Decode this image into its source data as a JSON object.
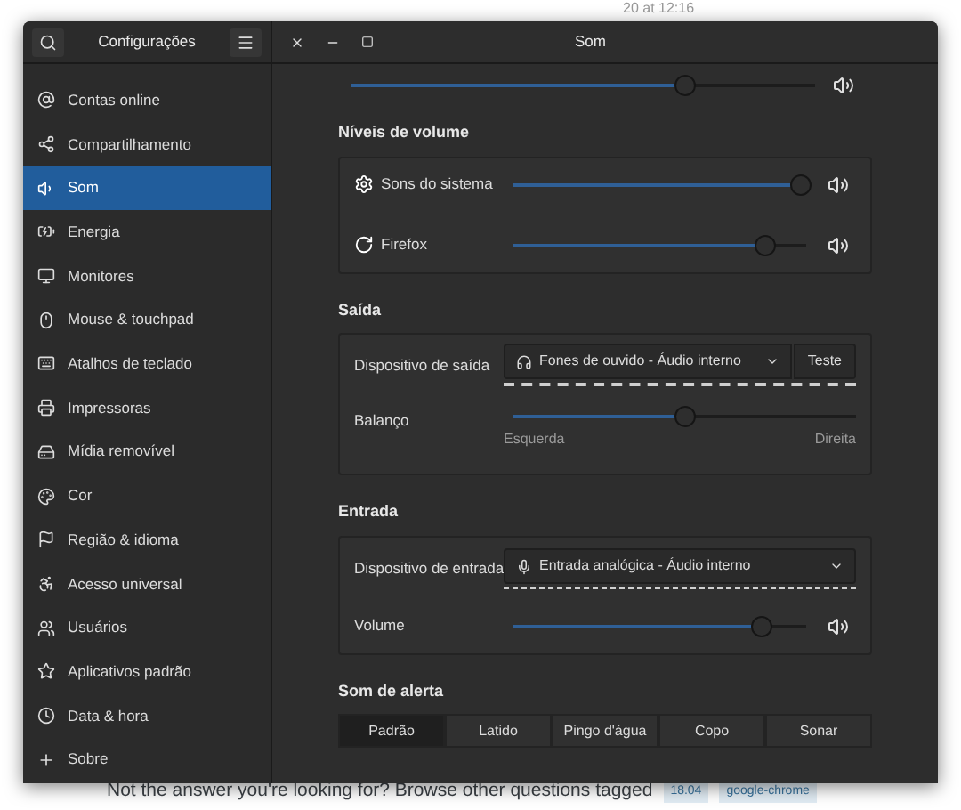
{
  "background_page": {
    "timestamp": "20 at 12:16",
    "footer_text": "Not the answer you're looking for? Browse other questions tagged",
    "tags": [
      "18.04",
      "google-chrome"
    ]
  },
  "sidebar": {
    "title": "Configurações",
    "items": [
      {
        "label": "Contas online",
        "selected": false
      },
      {
        "label": "Compartilhamento",
        "selected": false
      },
      {
        "label": "Som",
        "selected": true
      },
      {
        "label": "Energia",
        "selected": false
      },
      {
        "label": "Monitores",
        "selected": false
      },
      {
        "label": "Mouse & touchpad",
        "selected": false
      },
      {
        "label": "Atalhos de teclado",
        "selected": false
      },
      {
        "label": "Impressoras",
        "selected": false
      },
      {
        "label": "Mídia removível",
        "selected": false
      },
      {
        "label": "Cor",
        "selected": false
      },
      {
        "label": "Região & idioma",
        "selected": false
      },
      {
        "label": "Acesso universal",
        "selected": false
      },
      {
        "label": "Usuários",
        "selected": false
      },
      {
        "label": "Aplicativos padrão",
        "selected": false
      },
      {
        "label": "Data & hora",
        "selected": false
      },
      {
        "label": "Sobre",
        "selected": false
      }
    ]
  },
  "window": {
    "title": "Som"
  },
  "master_volume": {
    "level": 0.72
  },
  "volume_levels": {
    "heading": "Níveis de volume",
    "apps": [
      {
        "kind": "system",
        "name": "Sons do sistema",
        "level": 0.98
      },
      {
        "kind": "app",
        "name": "Firefox",
        "level": 0.86
      }
    ]
  },
  "output": {
    "heading": "Saída",
    "device_label": "Dispositivo de saída",
    "device": "Fones de ouvido - Áudio interno",
    "test_button": "Teste",
    "balance_label": "Balanço",
    "balance": {
      "level": 0.5
    },
    "left": "Esquerda",
    "right": "Direita"
  },
  "input": {
    "heading": "Entrada",
    "device_label": "Dispositivo de entrada",
    "device": "Entrada analógica - Áudio interno",
    "volume_label": "Volume",
    "volume": {
      "level": 0.85
    }
  },
  "alert_sound": {
    "heading": "Som de alerta",
    "options": [
      {
        "label": "Padrão",
        "selected": true
      },
      {
        "label": "Latido",
        "selected": false
      },
      {
        "label": "Pingo d'água",
        "selected": false
      },
      {
        "label": "Copo",
        "selected": false
      },
      {
        "label": "Sonar",
        "selected": false
      }
    ]
  }
}
